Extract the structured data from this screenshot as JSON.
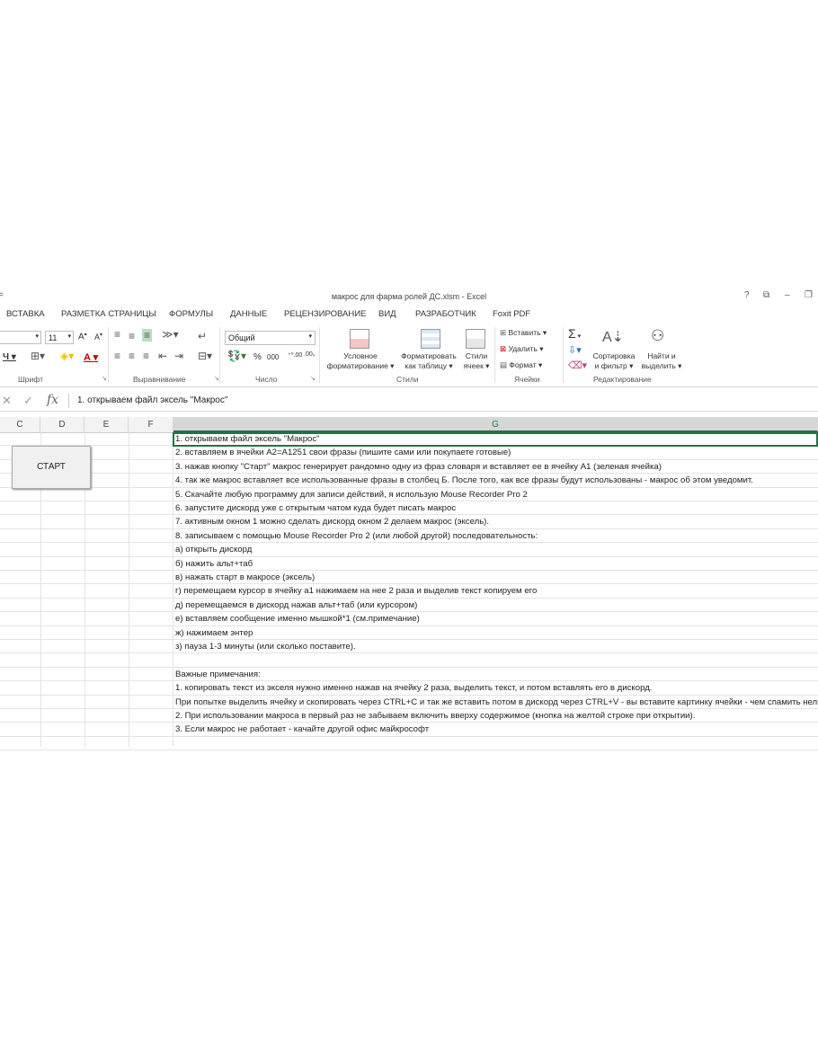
{
  "window": {
    "title": "макрос для фарма ролей ДС.xlsm - Excel",
    "help": "?",
    "ribbon_display": "⧉",
    "minimize": "–",
    "restore": "❐"
  },
  "tabs": [
    "ВСТАВКА",
    "РАЗМЕТКА СТРАНИЦЫ",
    "ФОРМУЛЫ",
    "ДАННЫЕ",
    "РЕЦЕНЗИРОВАНИЕ",
    "ВИД",
    "РАЗРАБОТЧИК",
    "Foxit PDF"
  ],
  "ribbon": {
    "font_size": "11",
    "number_format": "Общий",
    "groups": {
      "font": "Шрифт",
      "alignment": "Выравнивание",
      "number": "Число",
      "styles": "Стили",
      "cells": "Ячейки",
      "editing": "Редактирование"
    },
    "styles": {
      "conditional": [
        "Условное",
        "форматирование ▾"
      ],
      "as_table": [
        "Форматировать",
        "как таблицу ▾"
      ],
      "cell_styles": [
        "Стили",
        "ячеек ▾"
      ]
    },
    "cells": {
      "insert": "Вставить",
      "delete": "Удалить",
      "format": "Формат"
    },
    "editing": {
      "sort": [
        "Сортировка",
        "и фильтр ▾"
      ],
      "find": [
        "Найти и",
        "выделить ▾"
      ]
    }
  },
  "formula_bar": {
    "content": "1. открываем файл эксель \"Макрос\""
  },
  "columns": [
    "C",
    "D",
    "E",
    "F",
    "G"
  ],
  "start_button": "СТАРТ",
  "rows": [
    "1. открываем файл эксель \"Макрос\"",
    "2. вставляем в ячейки A2=A1251 свои фразы (пишите сами или покупаете готовые)",
    "3. нажав кнопку \"Старт\" макрос генерирует рандомно одну из фраз словаря и вставляет ее в ячейку A1 (зеленая ячейка)",
    "4. так же макрос вставляет все использованные фразы в столбец Б. После того, как все фразы будут использованы - макрос об этом уведомит.",
    "5. Скачайте любую программу для записи действий, я использую Mouse Recorder Pro 2",
    "6. запустите дискорд уже с открытым чатом куда будет писать макрос",
    "7. активным окном 1 можно сделать дискорд окном 2 делаем макрос (эксель).",
    "8. записываем с помощью Mouse Recorder Pro 2 (или любой другой) последовательность:",
    "а) открыть дискорд",
    "б) нажить альт+таб",
    "в) нажать старт в макросе (эксель)",
    "г) перемещаем курсор в ячейку а1 нажимаем на нее 2 раза и выделив текст копируем его",
    "д) перемещаемся в дискорд нажав альт+таб (или курсором)",
    "е) вставляем сообщение именно мышкой*1 (см.примечание)",
    "ж) нажимаем энтер",
    "з) пауза 1-3 минуты (или сколько поставите).",
    "",
    "Важные примечания:",
    "1. копировать текст из экселя нужно именно нажав на ячейку 2 раза, выделить текст, и потом вставлять его в дискорд.",
    "При попытке выделить ячейку и скопировать через CTRL+C и так же вставить потом в дискорд через CTRL+V - вы вставите картинку ячейки - чем спамить нельзя.",
    "2. При использовании макроса в первый раз не забываем включить вверху содержимое (кнопка на желтой строке при открытии).",
    "3. Если макрос не работает - качайте другой офис майкрософт",
    ""
  ]
}
